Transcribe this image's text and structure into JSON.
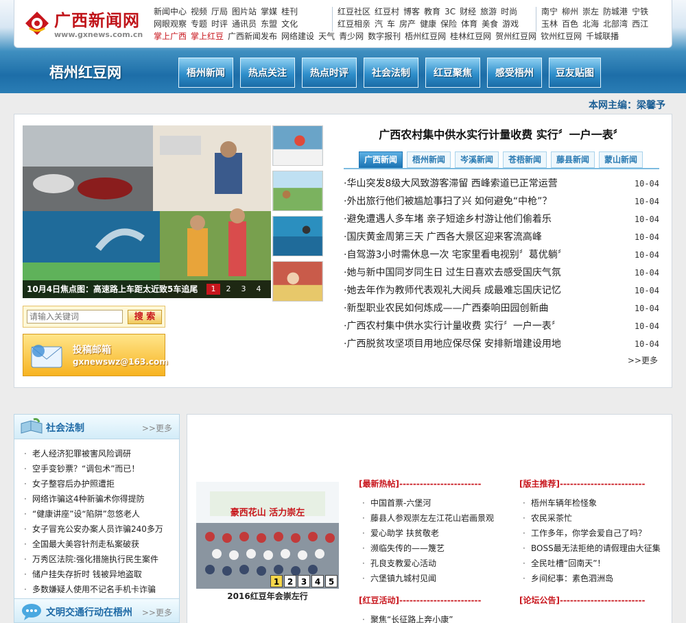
{
  "header": {
    "logo_text": "广西新闻网",
    "logo_url": "www.gxnews.com.cn",
    "nav_group1": [
      [
        "新闻中心",
        "视频",
        "厅局",
        "图片站",
        "掌媒",
        "桂刊"
      ],
      [
        "网眼观察",
        "专题",
        "时评",
        "通讯员",
        "东盟",
        "文化"
      ]
    ],
    "nav_group2": [
      [
        "红豆社区",
        "红豆村",
        "博客",
        "教育",
        "3C",
        "财经",
        "旅游",
        "时尚"
      ],
      [
        "红豆相亲",
        "汽",
        "车",
        "房产",
        "健康",
        "保险",
        "体育",
        "美食",
        "游戏"
      ]
    ],
    "nav_group3": [
      [
        "南宁",
        "柳州",
        "崇左",
        "防城港",
        "宁铁"
      ],
      [
        "玉林",
        "百色",
        "北海",
        "北部湾",
        "西江"
      ]
    ],
    "nav_row3": [
      "掌上广西",
      "掌上红豆",
      "广西新闻发布",
      "网络建设",
      "天气",
      "青少网",
      "数字报刊",
      "梧州红豆网",
      "桂林红豆网",
      "贺州红豆网",
      "钦州红豆网",
      "千城联播"
    ],
    "nav_row3_red_count": 2
  },
  "site_name": "梧州红豆网",
  "channels": [
    "梧州新闻",
    "热点关注",
    "热点时评",
    "社会法制",
    "红豆聚焦",
    "感受梧州",
    "豆友贴图"
  ],
  "editor": "本网主编：梁馨予",
  "focus": {
    "caption": "10月4日焦点图：高速路上车距太近致5车追尾",
    "pages": [
      "1",
      "2",
      "3",
      "4"
    ],
    "active_page": "1"
  },
  "search": {
    "placeholder": "请输入关键词",
    "button": "搜 索"
  },
  "mailbox": {
    "title": "投稿邮箱",
    "email": "gxnewswz@163.com"
  },
  "headline": "广西农村集中供水实行计量收费 实行〞一户一表〞",
  "tabs": [
    "广西新闻",
    "梧州新闻",
    "岑溪新闻",
    "苍梧新闻",
    "藤县新闻",
    "蒙山新闻"
  ],
  "active_tab": "广西新闻",
  "news": [
    {
      "title": "华山突发8级大风致游客滞留 西峰索道已正常运营",
      "date": "10-04"
    },
    {
      "title": "外出旅行他们被尴尬事扫了兴 如何避免“中枪”？",
      "date": "10-04"
    },
    {
      "title": "避免遭遇人多车堵 亲子短途乡村游让他们偷着乐",
      "date": "10-04"
    },
    {
      "title": "国庆黄金周第三天 广西各大景区迎来客流高峰",
      "date": "10-04"
    },
    {
      "title": "自驾游3小时需休息一次 宅家里看电视别〞葛优躺〞",
      "date": "10-04"
    },
    {
      "title": "她与新中国同岁同生日 过生日喜欢去感受国庆气氛",
      "date": "10-04"
    },
    {
      "title": "她去年作为教师代表观礼大阅兵 成最难忘国庆记忆",
      "date": "10-04"
    },
    {
      "title": "新型职业农民如何炼成——广西秦响田园创新曲",
      "date": "10-04"
    },
    {
      "title": "广西农村集中供水实行计量收费 实行〞一户一表〞",
      "date": "10-04"
    },
    {
      "title": "广西脱贫攻坚项目用地应保尽保 安排新增建设用地",
      "date": "10-04"
    }
  ],
  "more_label": ">>更多",
  "left_section": {
    "title": "社会法制",
    "more": ">>更多",
    "items": [
      "老人经济犯罪被害风险调研",
      "空手变钞票？“调包术”而已！",
      "女子整容后办护照遭拒",
      "网络诈骗这4种新骗术你得提防",
      "“健康讲座”设“陷阱”忽悠老人",
      "女子冒充公安办案人员诈骗240多万",
      "全国最大美容针剂走私案破获",
      "万秀区法院:强化措施执行民生案件",
      "储户挂失存折时 钱被异地盗取",
      "多数嫌疑人使用不记名手机卡诈骗"
    ]
  },
  "left_section2": {
    "title": "文明交通行动在梧州",
    "more": ">>更多"
  },
  "photo": {
    "banner": "豪西花山 活力崇左",
    "caption": "2016红豆年会崇左行",
    "pages": [
      "1",
      "2",
      "3",
      "4",
      "5"
    ],
    "active_page": "1"
  },
  "hot_posts": {
    "title": "[最新热帖]------------------------",
    "items": [
      "中国首票-六堡河",
      "藤县人参观崇左左江花山岩画景观",
      "爱心助学 扶贫敬老",
      "濒临失传的——篾艺",
      "孔良支教爱心活动",
      "六堡镇九城村见闻"
    ]
  },
  "recommend": {
    "title": "[版主推荐]-------------------------",
    "items": [
      "梧州车辆年检怪象",
      "农民采茶忙",
      "工作多年，你学会爱自己了吗？",
      "BOSS最无法拒绝的请假理由大征集",
      "全民吐槽“回南天”！",
      "乡间纪事：素色泗洲岛"
    ]
  },
  "events": {
    "title": "[红豆活动]------------------------",
    "items": [
      "聚焦“长征路上奔小康”"
    ]
  },
  "forum": {
    "title": "[论坛公告]-------------------------"
  },
  "colors": {
    "brand_red": "#c8161d",
    "channel_blue": "#1d6ea8",
    "link_blue": "#1e6aa6"
  }
}
